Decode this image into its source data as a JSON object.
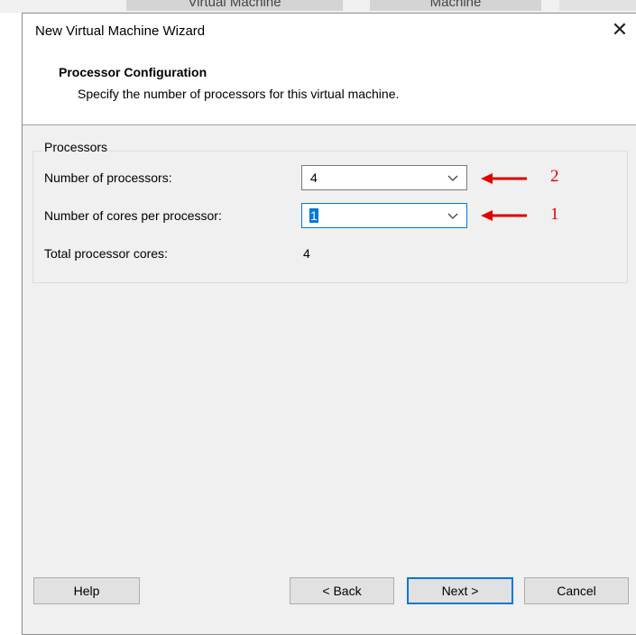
{
  "background": {
    "tab1": "Virtual Machine",
    "tab2": "Machine"
  },
  "dialog": {
    "title": "New Virtual Machine Wizard",
    "close_icon": "close-icon"
  },
  "header": {
    "title": "Processor Configuration",
    "subtitle": "Specify the number of processors for this virtual machine."
  },
  "processors": {
    "group_label": "Processors",
    "num_processors_label": "Number of processors:",
    "num_processors_value": "4",
    "cores_label": "Number of cores per processor:",
    "cores_value": "1",
    "total_label": "Total processor cores:",
    "total_value": "4"
  },
  "annotations": [
    {
      "number": "2",
      "color": "#e00000"
    },
    {
      "number": "1",
      "color": "#e00000"
    }
  ],
  "buttons": {
    "help": "Help",
    "back": "< Back",
    "next": "Next >",
    "cancel": "Cancel"
  },
  "colors": {
    "accent": "#0078d7",
    "annotation": "#e00000",
    "dialog_bg": "#f0f0f0"
  }
}
